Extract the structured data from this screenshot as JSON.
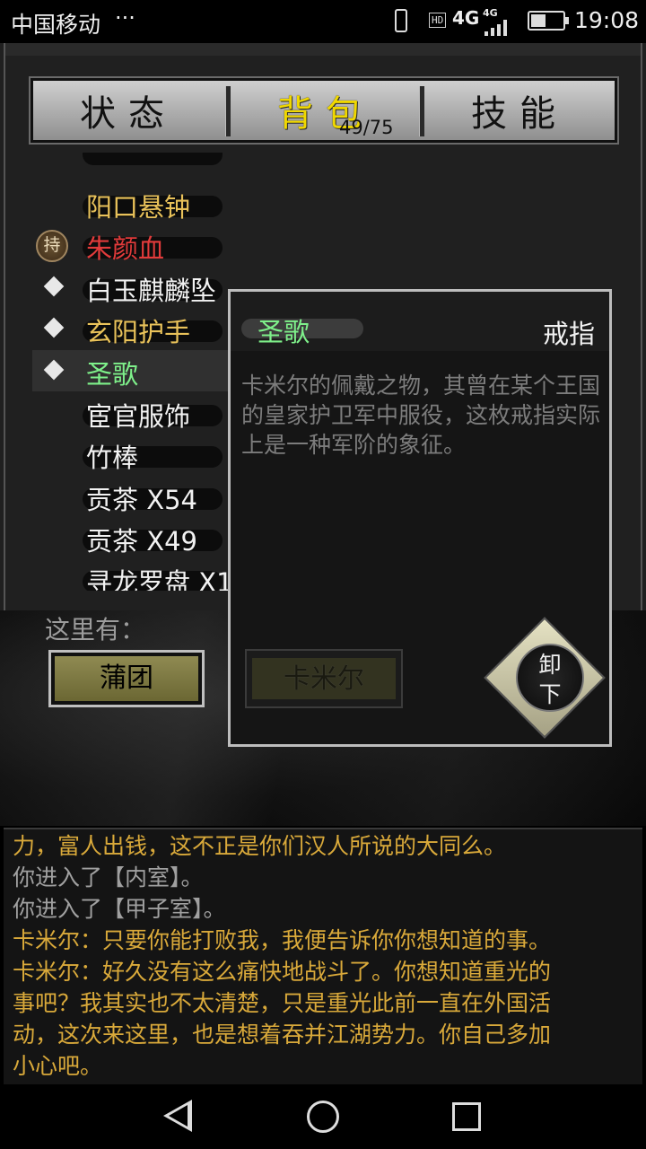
{
  "status_bar": {
    "carrier": "中国移动",
    "more": "···",
    "hd": "HD",
    "network": "4G",
    "network_small": "4G",
    "time": "19:08"
  },
  "tabs": [
    {
      "label": "状态",
      "active": false
    },
    {
      "label": "背包",
      "active": true
    },
    {
      "label": "技能",
      "active": false
    }
  ],
  "bag_count": "49/75",
  "items": [
    {
      "label": "阳口悬钟",
      "color": "#e9c25a",
      "marker": "none"
    },
    {
      "label": "朱颜血",
      "color": "#e23b3b",
      "marker": "持"
    },
    {
      "label": "白玉麒麟坠",
      "color": "#f2f2f2",
      "marker": "diamond"
    },
    {
      "label": "玄阳护手",
      "color": "#e9c25a",
      "marker": "diamond"
    },
    {
      "label": "圣歌",
      "color": "#7ef08a",
      "marker": "diamond",
      "selected": true
    },
    {
      "label": "宦官服饰",
      "color": "#f2f2f2",
      "marker": "none"
    },
    {
      "label": "竹棒",
      "color": "#f2f2f2",
      "marker": "none"
    },
    {
      "label": "贡茶 X54",
      "color": "#f2f2f2",
      "marker": "none"
    },
    {
      "label": "贡茶 X49",
      "color": "#f2f2f2",
      "marker": "none"
    },
    {
      "label": "寻龙罗盘 X1",
      "color": "#f2f2f2",
      "marker": "none"
    }
  ],
  "scene": {
    "here_label": "这里有：",
    "object_button": "蒲团"
  },
  "detail": {
    "name": "圣歌",
    "type": "戒指",
    "description": "卡米尔的佩戴之物，其曾在某个王国的皇家护卫军中服役，这枚戒指实际上是一种军阶的象征。",
    "npc_button": "卡米尔",
    "unequip_line1": "卸",
    "unequip_line2": "下"
  },
  "log": [
    {
      "text": "力，富人出钱，这不正是你们汉人所说的大同么。",
      "color": "#d9a93a"
    },
    {
      "text": "你进入了【内室】。",
      "color": "#a0a0a0"
    },
    {
      "text": "你进入了【甲子室】。",
      "color": "#a0a0a0"
    },
    {
      "text": "卡米尔：只要你能打败我，我便告诉你你想知道的事。",
      "color": "#d9a93a"
    },
    {
      "text": "卡米尔：好久没有这么痛快地战斗了。你想知道重光的",
      "color": "#d9a93a"
    },
    {
      "text": "事吧？我其实也不太清楚，只是重光此前一直在外国活",
      "color": "#d9a93a"
    },
    {
      "text": "动，这次来这里，也是想着吞并江湖势力。你自己多加",
      "color": "#d9a93a"
    },
    {
      "text": "小心吧。",
      "color": "#d9a93a"
    }
  ],
  "nav": {
    "back_icon": "back-triangle-icon",
    "home_icon": "home-circle-icon",
    "recent_icon": "recent-apps-square-icon"
  }
}
